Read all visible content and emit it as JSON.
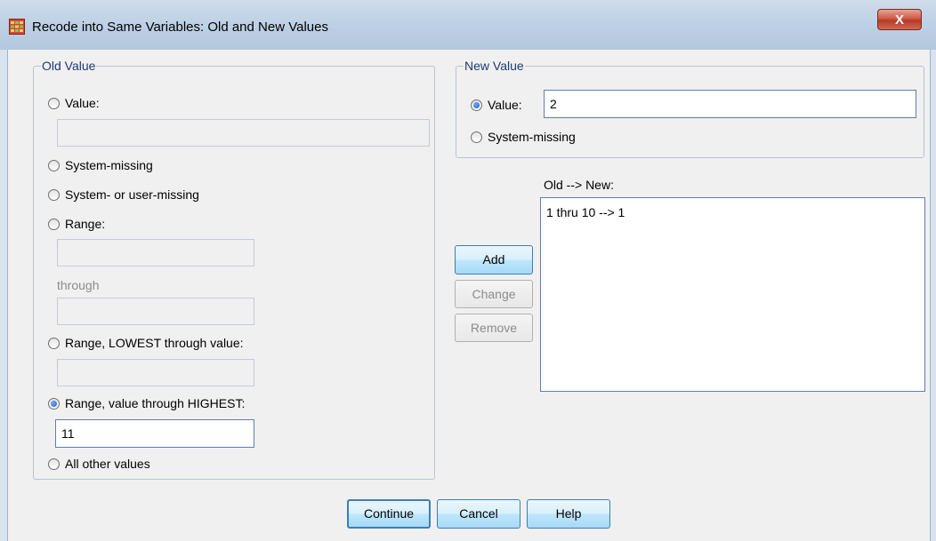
{
  "window": {
    "title": "Recode into Same Variables: Old and New Values",
    "close_label": "X",
    "icon": "spss-table-icon"
  },
  "old_value": {
    "legend": "Old Value",
    "value_label": "Value:",
    "value_input": "",
    "system_missing_label": "System-missing",
    "system_or_user_missing_label": "System- or user-missing",
    "range_label": "Range:",
    "range_from": "",
    "through_label": "through",
    "range_to": "",
    "range_lowest_label": "Range, LOWEST through value:",
    "range_lowest_input": "",
    "range_highest_label": "Range, value through HIGHEST:",
    "range_highest_input": "11",
    "all_other_label": "All other values",
    "selected": "range_highest"
  },
  "new_value": {
    "legend": "New Value",
    "value_label": "Value:",
    "value_input": "2",
    "system_missing_label": "System-missing",
    "selected": "value"
  },
  "mapping": {
    "label": "Old --> New:",
    "items": [
      "1 thru 10 --> 1"
    ]
  },
  "buttons": {
    "add": "Add",
    "change": "Change",
    "remove": "Remove",
    "continue": "Continue",
    "cancel": "Cancel",
    "help": "Help"
  }
}
